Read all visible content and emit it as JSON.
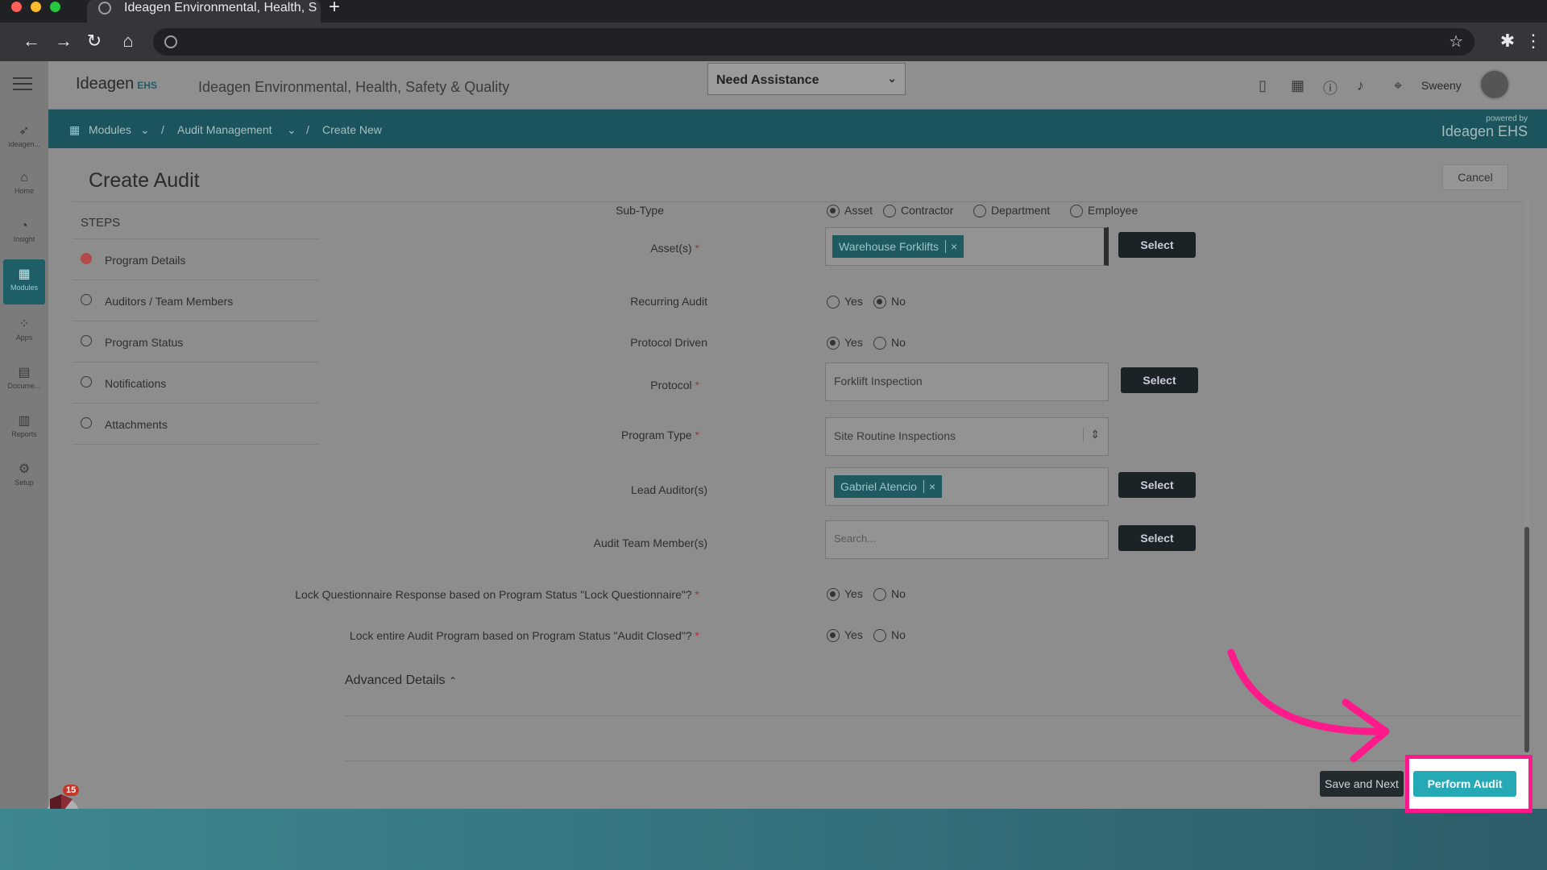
{
  "browser": {
    "tab_title": "Ideagen Environmental, Health, S",
    "new_tab": "+"
  },
  "app": {
    "logo": "Ideagen",
    "logo_suffix": "EHS",
    "title": "Ideagen Environmental, Health, Safety & Quality",
    "assist_label": "Need Assistance",
    "user_name": "Sweeny",
    "powered_by": "powered by",
    "powered_logo": "Ideagen EHS"
  },
  "rail": [
    {
      "label": "Ideagen...",
      "icon": "ideagen-icon"
    },
    {
      "label": "Home",
      "icon": "home-icon"
    },
    {
      "label": "Insight",
      "icon": "insight-icon"
    },
    {
      "label": "Modules",
      "icon": "modules-icon"
    },
    {
      "label": "Apps",
      "icon": "apps-icon"
    },
    {
      "label": "Docume...",
      "icon": "document-icon"
    },
    {
      "label": "Reports",
      "icon": "reports-icon"
    },
    {
      "label": "Setup",
      "icon": "setup-icon"
    }
  ],
  "breadcrumb": {
    "modules": "Modules",
    "audit": "Audit Management",
    "current": "Create New",
    "sep": "/"
  },
  "page": {
    "title": "Create Audit",
    "cancel": "Cancel"
  },
  "steps": {
    "title": "STEPS",
    "items": [
      {
        "label": "Program Details",
        "active": true
      },
      {
        "label": "Auditors / Team Members",
        "active": false
      },
      {
        "label": "Program Status",
        "active": false
      },
      {
        "label": "Notifications",
        "active": false
      },
      {
        "label": "Attachments",
        "active": false
      }
    ]
  },
  "form": {
    "subtype_label": "Sub-Type",
    "subtype_options": [
      "Asset",
      "Contractor",
      "Department",
      "Employee"
    ],
    "subtype_selected": "Asset",
    "assets_label": "Asset(s)",
    "asset_chip": "Warehouse Forklifts",
    "recurring_label": "Recurring Audit",
    "recurring_selected": "No",
    "protocol_driven_label": "Protocol Driven",
    "protocol_driven_selected": "Yes",
    "protocol_label": "Protocol",
    "protocol_value": "Forklift Inspection",
    "program_type_label": "Program Type",
    "program_type_value": "Site Routine Inspections",
    "lead_label": "Lead Auditor(s)",
    "lead_chip": "Gabriel Atencio",
    "team_label": "Audit Team Member(s)",
    "team_placeholder": "Search...",
    "lock_q_label": "Lock Questionnaire Response based on Program Status \"Lock Questionnaire\"?",
    "lock_q_selected": "Yes",
    "lock_a_label": "Lock entire Audit Program based on Program Status \"Audit Closed\"?",
    "lock_a_selected": "Yes",
    "yes": "Yes",
    "no": "No",
    "select": "Select",
    "req": "*",
    "chip_x": "×",
    "advanced": "Advanced Details"
  },
  "footer": {
    "save_next": "Save and Next",
    "perform": "Perform Audit",
    "notif_count": "15"
  },
  "colors": {
    "brand_teal": "#24a9b5",
    "highlight": "#ff1a8c",
    "breadcrumb_bg": "#1b545c"
  }
}
